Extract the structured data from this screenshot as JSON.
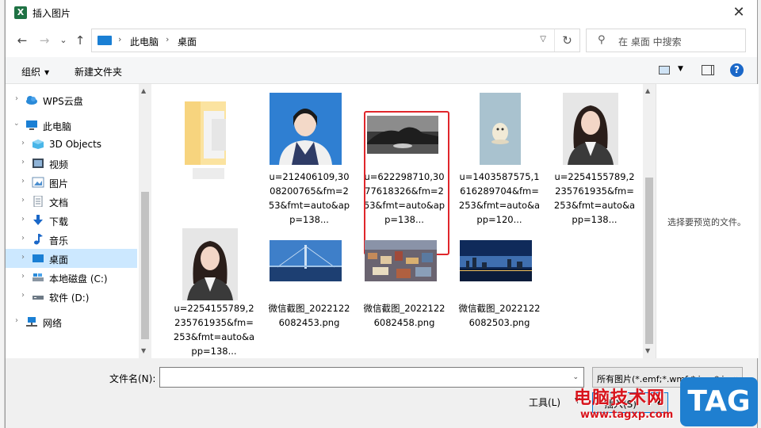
{
  "window": {
    "title": "插入图片",
    "close": "✕"
  },
  "nav": {
    "back": "←",
    "forward": "→",
    "recent": "⌄",
    "up": "↑",
    "breadcrumb": [
      "此电脑",
      "桌面"
    ],
    "refresh": "↻",
    "search_placeholder": "在 桌面 中搜索"
  },
  "toolbar": {
    "organize": "组织",
    "new_folder": "新建文件夹",
    "help": "?"
  },
  "sidebar": {
    "items": [
      {
        "label": "WPS云盘",
        "icon": "cloud-icon"
      },
      {
        "label": "此电脑",
        "icon": "pc-icon"
      },
      {
        "label": "3D Objects",
        "icon": "3d-objects-icon"
      },
      {
        "label": "视频",
        "icon": "video-icon"
      },
      {
        "label": "图片",
        "icon": "pictures-icon"
      },
      {
        "label": "文档",
        "icon": "documents-icon"
      },
      {
        "label": "下载",
        "icon": "download-icon"
      },
      {
        "label": "音乐",
        "icon": "music-icon"
      },
      {
        "label": "桌面",
        "icon": "desktop-icon",
        "selected": true
      },
      {
        "label": "本地磁盘 (C:)",
        "icon": "drive-icon"
      },
      {
        "label": "软件 (D:)",
        "icon": "drive-icon"
      },
      {
        "label": "网络",
        "icon": "network-icon"
      }
    ]
  },
  "files": [
    {
      "name": "",
      "thumb": "blurred-folder"
    },
    {
      "name": "u=212406109,3008200765&fm=253&fmt=auto&app=138...",
      "thumb": "portrait-blue"
    },
    {
      "name": "u=622298710,3077618326&fm=253&fmt=auto&app=138...",
      "thumb": "bw-landscape",
      "highlighted": true
    },
    {
      "name": "u=1403587575,1616289704&fm=253&fmt=auto&app=120...",
      "thumb": "cartoon-penguin"
    },
    {
      "name": "u=2254155789,2235761935&fm=253&fmt=auto&app=138...",
      "thumb": "portrait-gray"
    },
    {
      "name": "u=2254155789,2235761935&fm=253&fmt=auto&app=138...",
      "thumb": "portrait-gray"
    },
    {
      "name": "微信截图_20221226082453.png",
      "thumb": "city-bridge"
    },
    {
      "name": "微信截图_20221226082458.png",
      "thumb": "city-aerial"
    },
    {
      "name": "微信截图_20221226082503.png",
      "thumb": "city-night"
    }
  ],
  "preview": {
    "text": "选择要预览的文件。"
  },
  "bottom": {
    "filename_label": "文件名(N):",
    "filename_value": "",
    "filetype": "所有图片(*.emf;*.wmf;*.jpg;*.jp",
    "tools": "工具(L)",
    "open": "插入(S)"
  },
  "watermark": {
    "text": "电脑技术网",
    "url": "www.tagxp.com",
    "logo": "TAG"
  },
  "colors": {
    "accent": "#0078d7",
    "highlight_box": "#e0262b",
    "selected_row": "#cce8ff"
  }
}
